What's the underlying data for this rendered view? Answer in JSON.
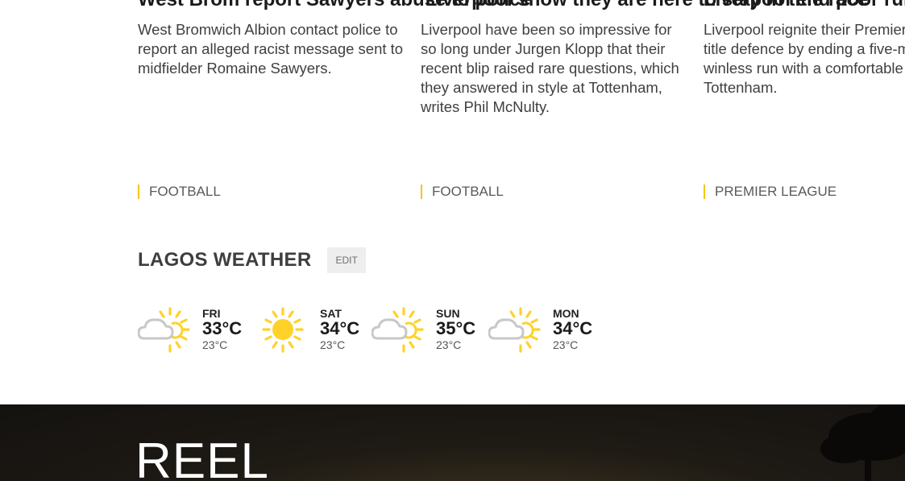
{
  "articles": [
    {
      "title": "West Brom report Sawyers abuse to police",
      "summary": "West Bromwich Albion contact police to report an alleged racist message sent to midfielder Romaine Sawyers.",
      "tag": "FOOTBALL"
    },
    {
      "title": "'Liverpool show they are here to stay in title race'",
      "summary": "Liverpool have been so impressive for so long under Jurgen Klopp that their recent blip raised rare questions, which they answered in style at Tottenham, writes Phil McNulty.",
      "tag": "FOOTBALL"
    },
    {
      "title": "Liverpool end poor run with win at Spurs",
      "summary": "Liverpool reignite their Premier League title defence by ending a five-match winless run with a comfortable win at Tottenham.",
      "tag": "PREMIER LEAGUE"
    }
  ],
  "weather": {
    "title": "LAGOS WEATHER",
    "edit_label": "EDIT",
    "days": [
      {
        "day": "FRI",
        "high": "33°C",
        "low": "23°C",
        "icon": "sun-behind-cloud-icon"
      },
      {
        "day": "SAT",
        "high": "34°C",
        "low": "23°C",
        "icon": "sun-icon"
      },
      {
        "day": "SUN",
        "high": "35°C",
        "low": "23°C",
        "icon": "sun-behind-cloud-icon"
      },
      {
        "day": "MON",
        "high": "34°C",
        "low": "23°C",
        "icon": "sun-behind-cloud-icon"
      }
    ]
  },
  "reel": {
    "title": "REEL"
  },
  "colors": {
    "tag_accent": "#f5c518",
    "sun": "#ffd22a",
    "cloud_outline": "#c8c8c8",
    "reel_background": "#1e1a14"
  }
}
